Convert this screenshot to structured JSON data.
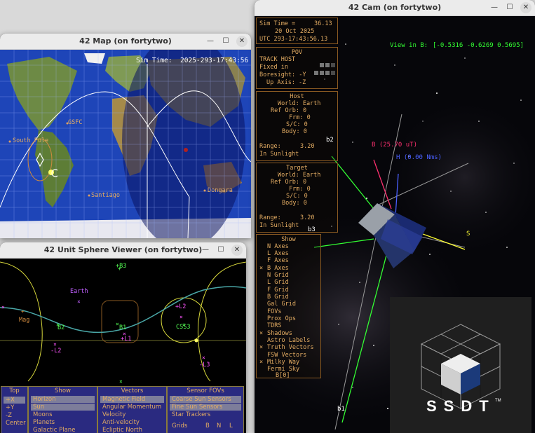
{
  "map": {
    "title": "42 Map (on fortytwo)",
    "time_label": "Sim Time:",
    "time_value": "2025-293-17:43:56",
    "labels": {
      "gsfc": "GSFC",
      "south_pole": "South Pole",
      "santiago": "Santiago",
      "dongara": "Dongara"
    }
  },
  "sphere": {
    "title": "42 Unit Sphere Viewer (on fortytwo)",
    "labels": {
      "b3": "+B3",
      "earth": "Earth",
      "mag": "Mag",
      "b2": "B2",
      "b1": "B1",
      "l1": "+L1",
      "l2pos": "+L2",
      "l2neg": "-L2",
      "css3": "CSS3",
      "l3": "-L3"
    },
    "panels": {
      "top": {
        "header": "Top",
        "rows": [
          "+X",
          "+Y",
          "-Z",
          "Center"
        ]
      },
      "show": {
        "header": "Show",
        "rows": [
          "Horizon",
          "Sun",
          "Moons",
          "Planets",
          "Galactic Plane"
        ]
      },
      "vectors": {
        "header": "Vectors",
        "rows": [
          "Magnetic Field",
          "Angular Momentum",
          "Velocity",
          "Anti-velocity",
          "Ecliptic North"
        ]
      },
      "sensor": {
        "header": "Sensor FOVs",
        "rows": [
          "Coarse Sun Sensors",
          "Fine Sun Sensors",
          "Star Trackers"
        ],
        "grids_label": "Grids",
        "grids_opts": [
          "B",
          "N",
          "L"
        ]
      }
    }
  },
  "cam": {
    "title": "42 Cam (on fortytwo)",
    "sim": {
      "label": "Sim Time =",
      "value": "36.13",
      "date": "20 Oct 2025",
      "utc": "UTC 293-17:43:56.13"
    },
    "view": {
      "label": "View in B:",
      "value": "[-0.5316 -0.6269  0.5695]"
    },
    "pov": {
      "header": "POV",
      "rows": [
        "TRACK HOST",
        "Fixed in",
        "Boresight: -Y",
        "Up Axis: -Z"
      ]
    },
    "host": {
      "header": "Host",
      "rows": [
        "World: Earth",
        "Ref Orb: 0",
        "Frm: 0",
        "S/C: 0",
        "Body: 0"
      ],
      "range_label": "Range:",
      "range_value": "3.20",
      "sun": "In Sunlight"
    },
    "target": {
      "header": "Target",
      "rows": [
        "World: Earth",
        "Ref Orb: 0",
        "Frm: 0",
        "S/C: 0",
        "Body: 0"
      ],
      "range_label": "Range:",
      "range_value": "3.20",
      "sun": "In Sunlight"
    },
    "show": {
      "header": "Show",
      "rows": [
        "N Axes",
        "L Axes",
        "F Axes",
        "B Axes",
        "N Grid",
        "L Grid",
        "F Grid",
        "B Grid",
        "Gal Grid",
        "FOVs",
        "Prox Ops",
        "TDRS",
        "Shadows",
        "Astro Labels",
        "Truth Vectors",
        "FSW Vectors",
        "Milky Way",
        "Fermi Sky"
      ],
      "footer": "B[0]"
    },
    "vectors": {
      "b_label": "B (25.70 uT)",
      "h_label": "H (0.00 Nms)",
      "s_label": "S",
      "b2": "b2",
      "b3": "b3",
      "b1": "b1"
    },
    "logo_text": "SSDT",
    "logo_tm": "TM"
  }
}
